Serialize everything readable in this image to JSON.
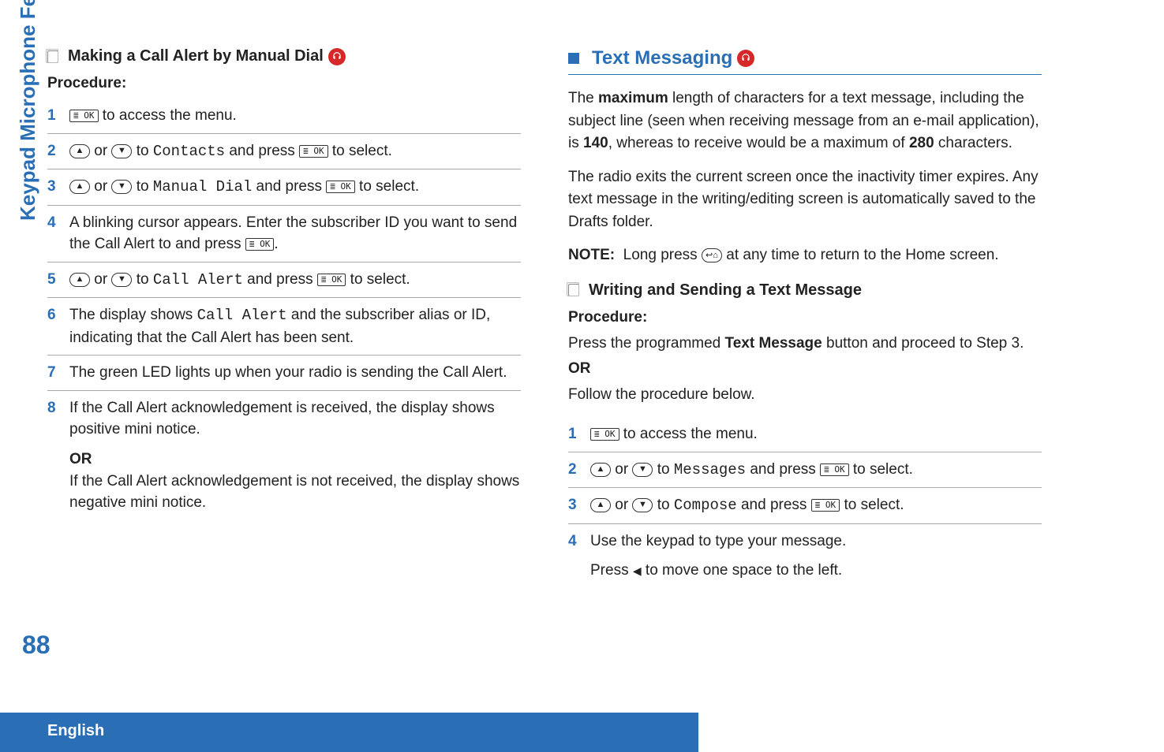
{
  "sideTab": "Keypad Microphone Features",
  "pageNumber": "88",
  "footerLang": "English",
  "left": {
    "heading": "Making a Call Alert by Manual Dial",
    "procLabel": "Procedure:",
    "steps": {
      "s1_a": " to access the menu.",
      "s2_a": " or ",
      "s2_b": " to ",
      "s2_contacts": "Contacts",
      "s2_c": " and press ",
      "s2_d": " to select.",
      "s3_a": " or ",
      "s3_b": " to ",
      "s3_manual": "Manual Dial",
      "s3_c": " and press ",
      "s3_d": " to select.",
      "s4": "A blinking cursor appears. Enter the subscriber ID you want to send the Call Alert to and press ",
      "s4_end": ".",
      "s5_a": " or ",
      "s5_b": " to ",
      "s5_call": "Call Alert",
      "s5_c": " and press ",
      "s5_d": " to select.",
      "s6_a": "The display shows ",
      "s6_call": "Call Alert",
      "s6_b": " and the subscriber alias or ID, indicating that the Call Alert has been sent.",
      "s7": "The green LED lights up when your radio is sending the Call Alert.",
      "s8_a": "If the Call Alert acknowledgement is received, the display shows positive mini notice.",
      "s8_or": "OR",
      "s8_b": "If the Call Alert acknowledgement is not received, the display shows negative mini notice."
    }
  },
  "right": {
    "heading": "Text Messaging",
    "para1_a": "The ",
    "para1_max": "maximum",
    "para1_b": " length of characters for a text message, including the subject line (seen when receiving message from an e-mail application), is ",
    "para1_140": "140",
    "para1_c": ", whereas to receive would be a maximum of ",
    "para1_280": "280",
    "para1_d": " characters.",
    "para2": "The radio exits the current screen once the inactivity timer expires. Any text message in the writing/editing screen is automatically saved to the Drafts folder.",
    "noteLabel": "NOTE:",
    "note_a": "Long press ",
    "note_b": " at any time to return to the Home screen.",
    "subheading": "Writing and Sending a Text Message",
    "procLabel": "Procedure:",
    "intro_a": "Press the programmed ",
    "intro_btn": "Text Message",
    "intro_b": " button and proceed to Step 3.",
    "intro_or": "OR",
    "intro_c": "Follow the procedure below.",
    "steps": {
      "s1_a": " to access the menu.",
      "s2_a": " or ",
      "s2_b": " to ",
      "s2_msg": "Messages",
      "s2_c": " and press ",
      "s2_d": " to select.",
      "s3_a": " or ",
      "s3_b": " to ",
      "s3_comp": "Compose",
      "s3_c": " and press ",
      "s3_d": " to select.",
      "s4_a": "Use the keypad to type your message.",
      "s4_b": "Press ",
      "s4_c": " to move one space to the left."
    }
  },
  "keys": {
    "ok": "≣ OK"
  }
}
